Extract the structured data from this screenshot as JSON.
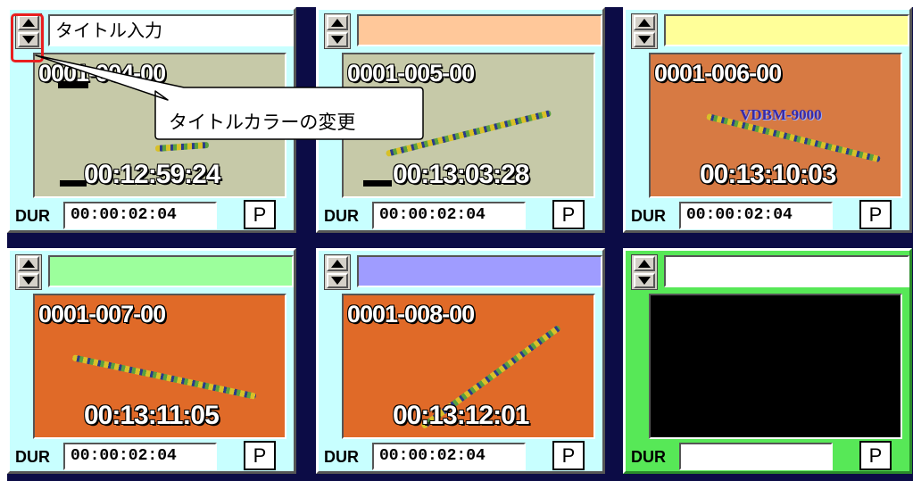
{
  "clips": [
    {
      "title": "タイトル入力",
      "title_color": "#ffffff",
      "thumb_bg": "#c6c9a8",
      "code": "0001-004-00",
      "time": "00:12:59:24",
      "dur_label": "DUR",
      "dur_value": "00:00:02:04",
      "p_label": "P"
    },
    {
      "title": "",
      "title_color": "#ffc89a",
      "thumb_bg": "#c6c9a8",
      "code": "0001-005-00",
      "time": "00:13:03:28",
      "dur_label": "DUR",
      "dur_value": "00:00:02:04",
      "p_label": "P"
    },
    {
      "title": "",
      "title_color": "#ffff99",
      "thumb_bg": "#d77a43",
      "code": "0001-006-00",
      "time": "00:13:10:03",
      "dur_label": "DUR",
      "dur_value": "00:00:02:04",
      "p_label": "P",
      "logo": "VDBM-9000"
    },
    {
      "title": "",
      "title_color": "#9cff9c",
      "thumb_bg": "#e06a28",
      "code": "0001-007-00",
      "time": "00:13:11:05",
      "dur_label": "DUR",
      "dur_value": "00:00:02:04",
      "p_label": "P"
    },
    {
      "title": "",
      "title_color": "#9f9cff",
      "thumb_bg": "#e06a28",
      "code": "0001-008-00",
      "time": "00:13:12:01",
      "dur_label": "DUR",
      "dur_value": "00:00:02:04",
      "p_label": "P"
    },
    {
      "title": "",
      "title_color": "#ffffff",
      "thumb_bg": "#000000",
      "code": "",
      "time": "",
      "dur_label": "DUR",
      "dur_value": "",
      "p_label": "P",
      "selected": true
    }
  ],
  "callout": {
    "text": "タイトルカラーの変更"
  },
  "colors": {
    "grid_bg": "#0c0c46",
    "clip_bg": "#c8ffff",
    "selected_bg": "#57e857",
    "highlight": "#e81f1f"
  }
}
